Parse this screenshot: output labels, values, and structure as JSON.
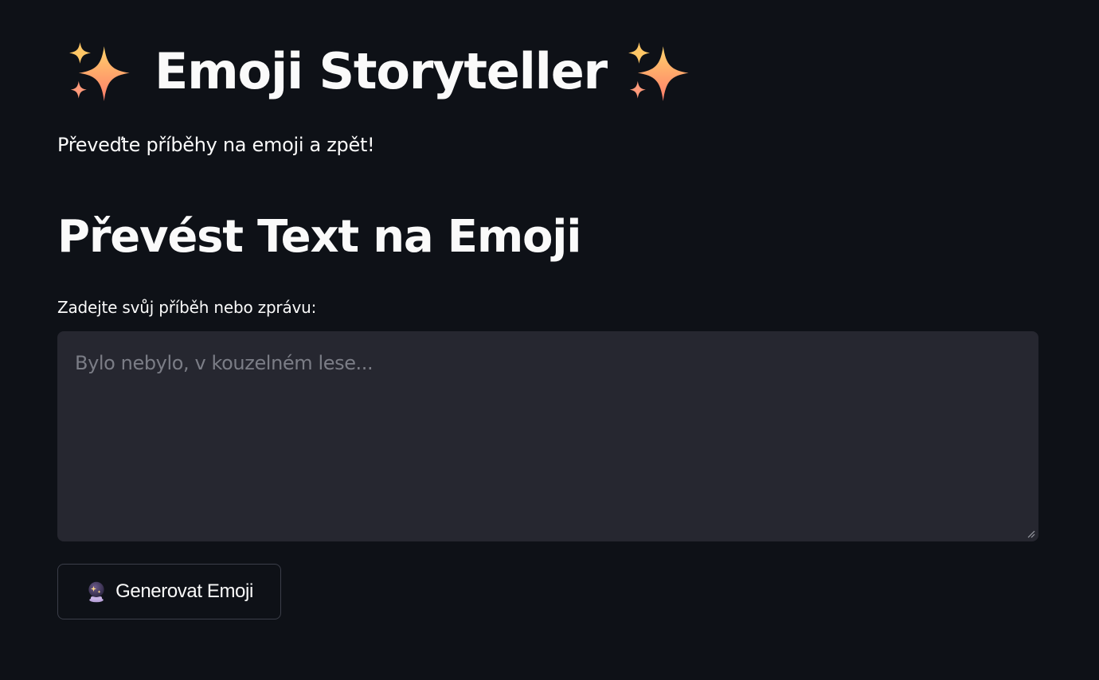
{
  "header": {
    "title": "Emoji Storyteller",
    "leading_icon": "sparkles-icon",
    "trailing_icon": "sparkles-icon",
    "subtitle": "Převeďte příběhy na emoji a zpět!"
  },
  "section": {
    "heading": "Převést Text na Emoji",
    "input_label": "Zadejte svůj příběh nebo zprávu:",
    "input_placeholder": "Bylo nebylo, v kouzelném lese...",
    "input_value": ""
  },
  "actions": {
    "generate_icon": "crystal-ball-icon",
    "generate_label": "Generovat Emoji"
  },
  "colors": {
    "background": "#0e1117",
    "input_background": "#262730",
    "text": "#fafafa",
    "placeholder": "#7b7d86",
    "button_border": "#3b3e49"
  }
}
